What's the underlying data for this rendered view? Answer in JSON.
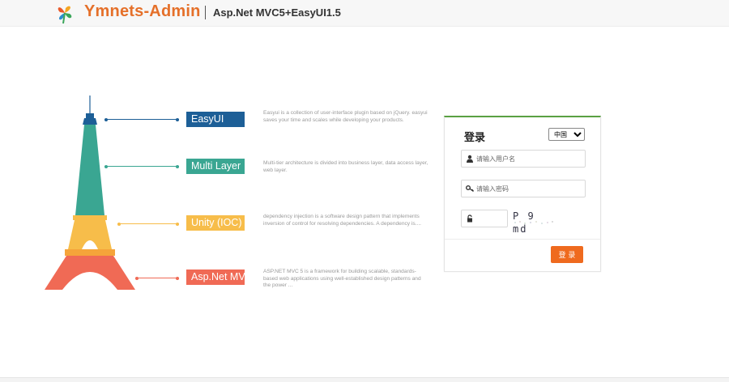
{
  "header": {
    "brand": "Ymnets-Admin",
    "subtitle": "Asp.Net MVC5+EasyUI1.5"
  },
  "features": [
    {
      "label": "EasyUI",
      "color": "#1d5f97",
      "description": "Easyui is a collection of user-interface plugin based on jQuery. easyui saves your time and scales while developing your products."
    },
    {
      "label": "Multi Layer",
      "color": "#3aa692",
      "description": "Multi-tier architecture is divided into business layer, data access layer, web layer."
    },
    {
      "label": "Unity (IOC)",
      "color": "#f7bd4a",
      "description": "dependency injection is a software design pattern that implements inversion of control for resolving dependencies. A dependency is...."
    },
    {
      "label": "Asp.Net MVC",
      "color": "#f06a55",
      "description": "ASP.NET MVC 5 is a framework for building scalable, standards-based web applications using well-established design patterns and the power ..."
    }
  ],
  "login": {
    "title": "登录",
    "language_selected": "中国",
    "username_placeholder": "请输入用户名",
    "password_placeholder": "请输入密码",
    "captcha_text": "P 9 md",
    "submit_label": "登 录",
    "accent_color": "#ef6a1e",
    "top_border_color": "#5aa142"
  },
  "icons": {
    "logo": "clover-logo-icon",
    "username": "user-icon",
    "password": "key-icon",
    "captcha": "lock-icon"
  }
}
